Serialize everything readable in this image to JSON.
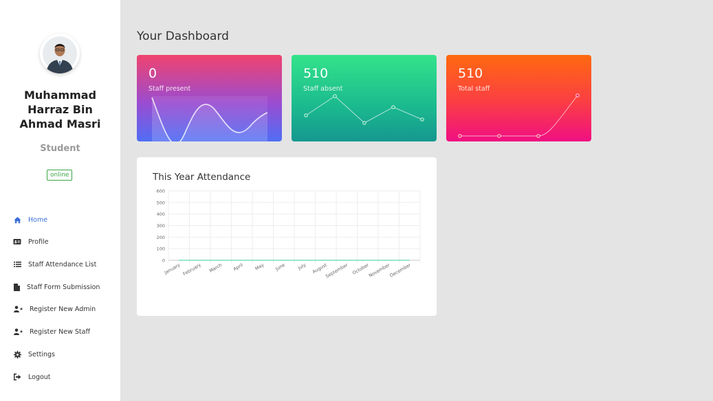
{
  "user": {
    "name_lines": [
      "Muhammad",
      "Harraz Bin",
      "Ahmad Masri"
    ],
    "role": "Student",
    "status": "online"
  },
  "nav": {
    "items": [
      {
        "label": "Home",
        "icon": "home-icon",
        "active": true
      },
      {
        "label": "Profile",
        "icon": "id-card-icon",
        "active": false
      },
      {
        "label": "Staff Attendance List",
        "icon": "list-icon",
        "active": false
      },
      {
        "label": "Staff Form Submission",
        "icon": "file-icon",
        "active": false
      },
      {
        "label": "Register New Admin",
        "icon": "user-plus-icon",
        "active": false
      },
      {
        "label": "Register New Staff",
        "icon": "user-plus-icon",
        "active": false
      },
      {
        "label": "Settings",
        "icon": "gear-icon",
        "active": false
      },
      {
        "label": "Logout",
        "icon": "sign-out-icon",
        "active": false
      }
    ]
  },
  "dashboard": {
    "title": "Your Dashboard",
    "cards": [
      {
        "value": "0",
        "label": "Staff present"
      },
      {
        "value": "510",
        "label": "Staff absent"
      },
      {
        "value": "510",
        "label": "Total staff"
      }
    ]
  },
  "attendance": {
    "title": "This Year Attendance"
  },
  "colors": {
    "accent": "#3a6fd8",
    "online": "#3aa545",
    "card_present": [
      "#f0436e",
      "#4f6ef5"
    ],
    "card_absent": [
      "#34e38a",
      "#15978f"
    ],
    "card_total": [
      "#ff6a0f",
      "#f00f83"
    ]
  },
  "chart_data": {
    "type": "line",
    "title": "This Year Attendance",
    "categories": [
      "January",
      "February",
      "March",
      "April",
      "May",
      "June",
      "July",
      "August",
      "September",
      "October",
      "November",
      "December"
    ],
    "yticks": [
      0,
      100,
      200,
      300,
      400,
      500,
      600
    ],
    "ylim": [
      0,
      600
    ],
    "series": [
      {
        "values": [
          0,
          0,
          0,
          0,
          0,
          0,
          0,
          0,
          0,
          0,
          0,
          0
        ]
      }
    ],
    "grid": true
  }
}
